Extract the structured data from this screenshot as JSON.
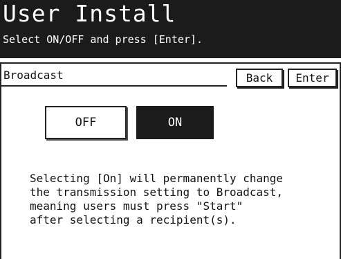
{
  "header": {
    "title": "User Install",
    "subtitle": "Select ON/OFF and press [Enter]."
  },
  "panel": {
    "label": "Broadcast",
    "back_label": "Back",
    "enter_label": "Enter",
    "off_label": "OFF",
    "on_label": "ON",
    "selected": "ON",
    "message_lines": [
      "Selecting [On] will permanently change",
      "the transmission setting to Broadcast,",
      "meaning users must press \"Start\"",
      "after selecting a recipient(s)."
    ]
  },
  "colors": {
    "header_bg": "#1b1b1b",
    "selected_bg": "#1b1b1b",
    "text": "#111111"
  }
}
